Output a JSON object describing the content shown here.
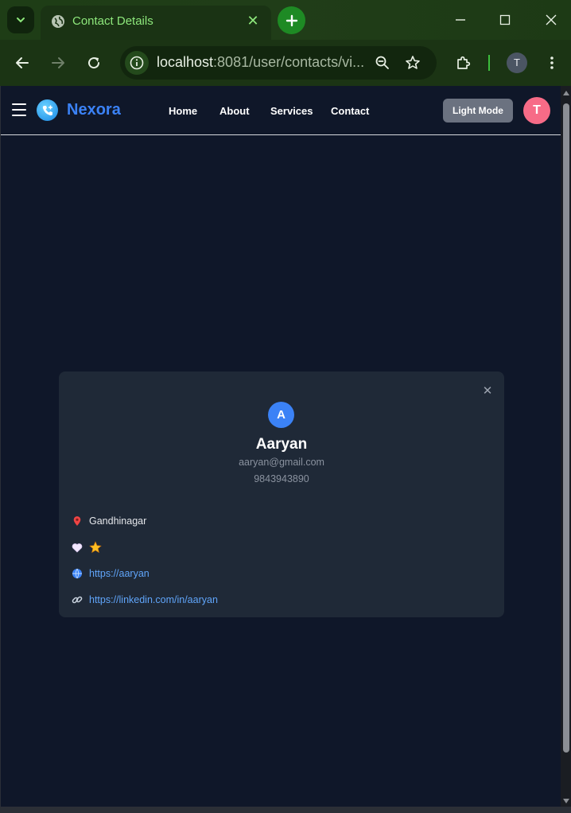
{
  "browser": {
    "tab_title": "Contact Details",
    "url_host": "localhost",
    "url_rest": ":8081/user/contacts/vi...",
    "profile_initial": "T",
    "accent_color": "#8ee87c"
  },
  "navbar": {
    "brand": "Nexora",
    "links": [
      "Home",
      "About",
      "Services",
      "Contact"
    ],
    "theme_button": "Light Mode",
    "avatar_initial": "T",
    "brand_color": "#3b82f6",
    "avatar_color": "#f76b87"
  },
  "contact": {
    "avatar_initial": "A",
    "name": "Aaryan",
    "email": "aaryan@gmail.com",
    "phone": "9843943890",
    "address": "Gandhinagar",
    "website": "https://aaryan",
    "linkedin": "https://linkedin.com/in/aaryan",
    "favorite_icon": "star-icon",
    "close_icon": "close-icon"
  }
}
